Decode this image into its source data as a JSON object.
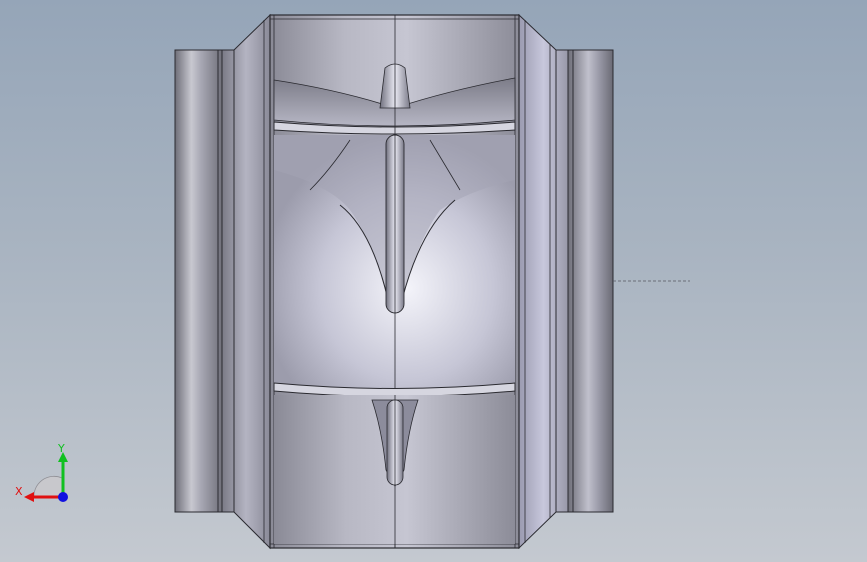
{
  "viewport": {
    "background_top": "#95a5b8",
    "background_bottom": "#c4c9d0"
  },
  "model": {
    "part": "fan-housing-with-blades",
    "view": "front"
  },
  "triad": {
    "x_label": "X",
    "y_label": "Y",
    "x_color": "#e01010",
    "y_color": "#10c020",
    "z_color": "#1010e0"
  }
}
